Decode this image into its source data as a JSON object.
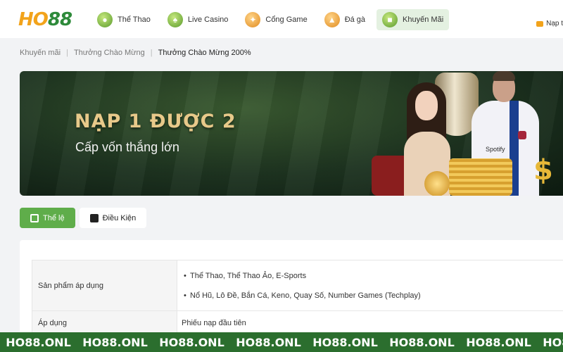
{
  "header": {
    "logo_part1": "HO",
    "logo_part2": "88",
    "nav": [
      {
        "label": "Thể Thao",
        "icon": "soccer-ball-icon"
      },
      {
        "label": "Live Casino",
        "icon": "dealer-icon"
      },
      {
        "label": "Cổng Game",
        "icon": "gamepad-icon"
      },
      {
        "label": "Đá gà",
        "icon": "rooster-icon"
      },
      {
        "label": "Khuyến Mãi",
        "icon": "gift-icon",
        "active": true
      }
    ],
    "right_label": "Nạp t"
  },
  "breadcrumb": {
    "items": [
      "Khuyến mãi",
      "Thưởng Chào Mừng",
      "Thưởng Chào Mừng 200%"
    ]
  },
  "banner": {
    "title": "NẠP 1 ĐƯỢC 2",
    "subtitle": "Cấp vốn thắng lớn",
    "sponsor_text": "Spotify"
  },
  "tabs": [
    {
      "label": "Thể lệ",
      "active": true
    },
    {
      "label": "Điều Kiện",
      "active": false
    }
  ],
  "rules_table": {
    "rows": [
      {
        "label": "Sản phẩm áp dụng",
        "values": [
          "Thể Thao, Thể Thao Ảo, E-Sports",
          "Nổ Hũ, Lô Đề, Bắn Cá, Keno, Quay Số, Number Games (Techplay)"
        ]
      },
      {
        "label": "Áp dụng",
        "value": "Phiếu nạp đầu tiên"
      }
    ]
  },
  "watermark": {
    "text": "HO88.ONL",
    "repeat": 8
  },
  "colors": {
    "brand_green": "#5fad4a",
    "brand_orange": "#f2a31b",
    "strip_green": "#2b6e2e",
    "banner_title_gold": "#e8c98a"
  }
}
